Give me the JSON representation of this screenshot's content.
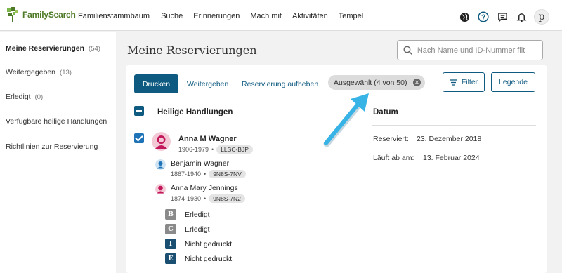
{
  "brand": {
    "name": "FamilySearch"
  },
  "nav": {
    "items": [
      "Familienstammbaum",
      "Suche",
      "Erinnerungen",
      "Mach mit",
      "Aktivitäten",
      "Tempel"
    ]
  },
  "top_icons": [
    "globe-icon",
    "help-icon",
    "messages-icon",
    "bell-icon"
  ],
  "user": {
    "initial": "p"
  },
  "sidebar": {
    "items": [
      {
        "label": "Meine Reservierungen",
        "count": "(54)",
        "active": true
      },
      {
        "label": "Weitergegeben",
        "count": "(13)"
      },
      {
        "label": "Erledigt",
        "count": "(0)"
      },
      {
        "label": "Verfügbare heilige Handlungen",
        "count": ""
      },
      {
        "label": "Richtlinien zur Reservierung",
        "count": ""
      }
    ]
  },
  "main": {
    "title": "Meine Reservierungen",
    "search_placeholder": "Nach Name und ID-Nummer filt",
    "toolbar": {
      "print": "Drucken",
      "share": "Weitergeben",
      "unreserve": "Reservierung aufheben",
      "selected_chip": "Ausgewählt (4 von 50)",
      "filter": "Filter",
      "legend": "Legende"
    },
    "columns": {
      "ordinances": "Heilige Handlungen",
      "date": "Datum"
    },
    "record": {
      "person": {
        "name": "Anna M Wagner",
        "dates": "1906-1979",
        "id": "LLSC-BJP"
      },
      "father": {
        "name": "Benjamin Wagner",
        "dates": "1867-1940",
        "id": "9N8S-7NV"
      },
      "mother": {
        "name": "Anna Mary Jennings",
        "dates": "1874-1930",
        "id": "9N8S-7N2"
      },
      "ordinances": [
        {
          "letter": "B",
          "status": "Erledigt",
          "state": "done"
        },
        {
          "letter": "C",
          "status": "Erledigt",
          "state": "done"
        },
        {
          "letter": "I",
          "status": "Nicht gedruckt",
          "state": "pending"
        },
        {
          "letter": "E",
          "status": "Nicht gedruckt",
          "state": "pending"
        }
      ],
      "reserved_label": "Reserviert:",
      "reserved_date": "23. Dezember 2018",
      "expires_label": "Läuft ab am:",
      "expires_date": "13. Februar 2024"
    }
  },
  "colors": {
    "primary": "#0e5a80",
    "brand_green": "#4f7a28",
    "female": "#c2185b",
    "male": "#1f74b8",
    "annotation_arrow": "#38b3e6"
  }
}
